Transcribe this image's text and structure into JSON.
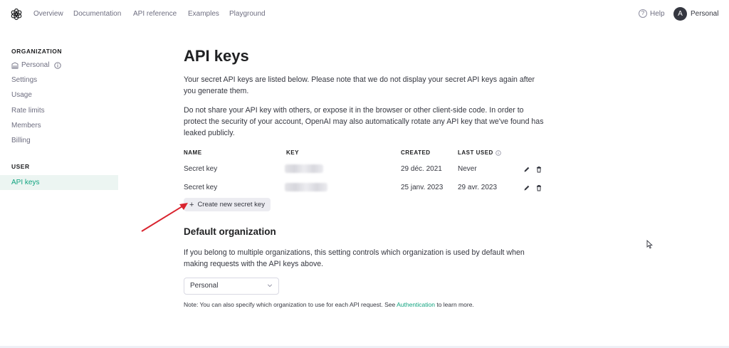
{
  "nav": {
    "links": [
      "Overview",
      "Documentation",
      "API reference",
      "Examples",
      "Playground"
    ],
    "help_label": "Help",
    "avatar_letter": "A",
    "profile_name": "Personal"
  },
  "sidebar": {
    "organization_heading": "ORGANIZATION",
    "org_items": [
      "Personal",
      "Settings",
      "Usage",
      "Rate limits",
      "Members",
      "Billing"
    ],
    "user_heading": "USER",
    "user_items": [
      "API keys"
    ]
  },
  "main": {
    "title": "API keys",
    "intro_1": "Your secret API keys are listed below. Please note that we do not display your secret API keys again after you generate them.",
    "intro_2": "Do not share your API key with others, or expose it in the browser or other client-side code. In order to protect the security of your account, OpenAI may also automatically rotate any API key that we've found has leaked publicly.",
    "table": {
      "headers": [
        "NAME",
        "KEY",
        "CREATED",
        "LAST USED"
      ],
      "rows": [
        {
          "name": "Secret key",
          "created": "29 déc. 2021",
          "last_used": "Never"
        },
        {
          "name": "Secret key",
          "created": "25 janv. 2023",
          "last_used": "29 avr. 2023"
        }
      ]
    },
    "create_button": "Create new secret key",
    "default_org_title": "Default organization",
    "default_org_text": "If you belong to multiple organizations, this setting controls which organization is used by default when making requests with the API keys above.",
    "org_select_value": "Personal",
    "note_prefix": "Note: You can also specify which organization to use for each API request. See ",
    "note_link": "Authentication",
    "note_suffix": " to learn more."
  },
  "colors": {
    "accent": "#10a37f",
    "annotation_arrow": "#d9232e"
  },
  "icons": [
    "openai-logo-icon",
    "help-icon",
    "building-icon",
    "info-icon",
    "pencil-icon",
    "trash-icon",
    "chevron-down-icon",
    "plus-icon",
    "mouse-cursor-icon"
  ]
}
